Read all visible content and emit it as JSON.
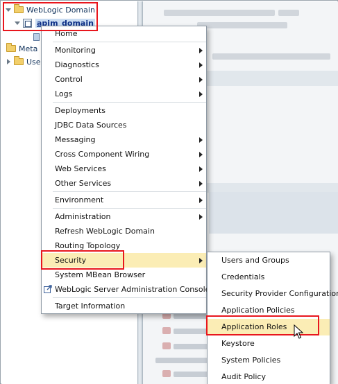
{
  "tree": {
    "weblogic_domain": "WebLogic Domain",
    "apim_domain": "apim_domain",
    "meta_partial": "Meta",
    "user_partial": "User"
  },
  "context_menu": {
    "items": [
      {
        "label": "Home",
        "submenu": false
      },
      {
        "label": "Monitoring",
        "submenu": true
      },
      {
        "label": "Diagnostics",
        "submenu": true
      },
      {
        "label": "Control",
        "submenu": true
      },
      {
        "label": "Logs",
        "submenu": true
      },
      {
        "label": "Deployments",
        "submenu": false
      },
      {
        "label": "JDBC Data Sources",
        "submenu": false
      },
      {
        "label": "Messaging",
        "submenu": true
      },
      {
        "label": "Cross Component Wiring",
        "submenu": true
      },
      {
        "label": "Web Services",
        "submenu": true
      },
      {
        "label": "Other Services",
        "submenu": true
      },
      {
        "label": "Environment",
        "submenu": true
      },
      {
        "label": "Administration",
        "submenu": true
      },
      {
        "label": "Refresh WebLogic Domain",
        "submenu": false
      },
      {
        "label": "Routing Topology",
        "submenu": false
      },
      {
        "label": "Security",
        "submenu": true,
        "active": true
      },
      {
        "label": "System MBean Browser",
        "submenu": false
      },
      {
        "label": "WebLogic Server Administration Console",
        "submenu": false,
        "icon": "external-link-icon"
      },
      {
        "label": "Target Information",
        "submenu": false
      }
    ]
  },
  "security_submenu": {
    "items": [
      {
        "label": "Users and Groups"
      },
      {
        "label": "Credentials"
      },
      {
        "label": "Security Provider Configuration"
      },
      {
        "label": "Application Policies"
      },
      {
        "label": "Application Roles",
        "hover": true
      },
      {
        "label": "Keystore"
      },
      {
        "label": "System Policies"
      },
      {
        "label": "Audit Policy"
      }
    ]
  },
  "colors": {
    "highlight_red": "#e8161d",
    "active_item_bg": "#fbedb5",
    "tree_selected_text": "#0d2f86"
  }
}
